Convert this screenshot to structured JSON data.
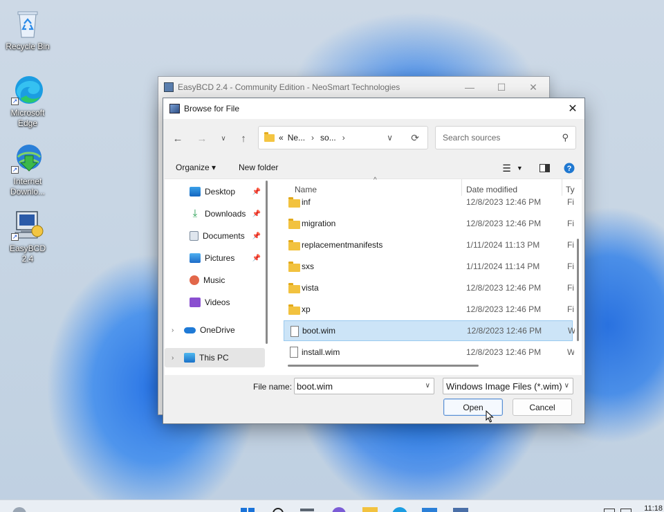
{
  "desktop": {
    "icons": [
      {
        "label": "Recycle Bin"
      },
      {
        "label": "Microsoft Edge"
      },
      {
        "label": "Internet Downlo..."
      },
      {
        "label": "EasyBCD 2.4"
      }
    ]
  },
  "background_window": {
    "title": "EasyBCD 2.4 - Community Edition - NeoSmart Technologies"
  },
  "dialog": {
    "title": "Browse for File",
    "address": {
      "overflow": "«",
      "crumbs": [
        "Ne...",
        "so..."
      ]
    },
    "search_placeholder": "Search sources",
    "toolbar": {
      "organize": "Organize ▾",
      "new_folder": "New folder"
    },
    "nav_tree": [
      {
        "label": "Desktop",
        "icon": "desktop-icon",
        "pinned": true
      },
      {
        "label": "Downloads",
        "icon": "downloads-icon",
        "pinned": true
      },
      {
        "label": "Documents",
        "icon": "documents-icon",
        "pinned": true
      },
      {
        "label": "Pictures",
        "icon": "pictures-icon",
        "pinned": true
      },
      {
        "label": "Music",
        "icon": "music-icon",
        "pinned": false
      },
      {
        "label": "Videos",
        "icon": "videos-icon",
        "pinned": false
      },
      {
        "label": "OneDrive",
        "icon": "onedrive-icon",
        "pinned": false
      },
      {
        "label": "This PC",
        "icon": "this-pc-icon",
        "pinned": false
      }
    ],
    "columns": {
      "name": "Name",
      "date": "Date modified",
      "type": "Ty"
    },
    "files": [
      {
        "name": "inf",
        "date": "12/8/2023 12:46 PM",
        "type": "Fi",
        "kind": "folder"
      },
      {
        "name": "migration",
        "date": "12/8/2023 12:46 PM",
        "type": "Fi",
        "kind": "folder"
      },
      {
        "name": "replacementmanifests",
        "date": "1/11/2024 11:13 PM",
        "type": "Fi",
        "kind": "folder"
      },
      {
        "name": "sxs",
        "date": "1/11/2024 11:14 PM",
        "type": "Fi",
        "kind": "folder"
      },
      {
        "name": "vista",
        "date": "12/8/2023 12:46 PM",
        "type": "Fi",
        "kind": "folder"
      },
      {
        "name": "xp",
        "date": "12/8/2023 12:46 PM",
        "type": "Fi",
        "kind": "folder"
      },
      {
        "name": "boot.wim",
        "date": "12/8/2023 12:46 PM",
        "type": "W",
        "kind": "file",
        "selected": true
      },
      {
        "name": "install.wim",
        "date": "12/8/2023 12:46 PM",
        "type": "W",
        "kind": "file"
      }
    ],
    "file_name_label": "File name:",
    "file_name_value": "boot.wim",
    "file_type_value": "Windows Image Files (*.wim)",
    "open_label": "Open",
    "cancel_label": "Cancel"
  },
  "taskbar": {
    "clock": "11:18"
  },
  "colors": {
    "selection_bg": "#cce4f7",
    "folder": "#f2c23f",
    "accent": "#0067c0"
  }
}
